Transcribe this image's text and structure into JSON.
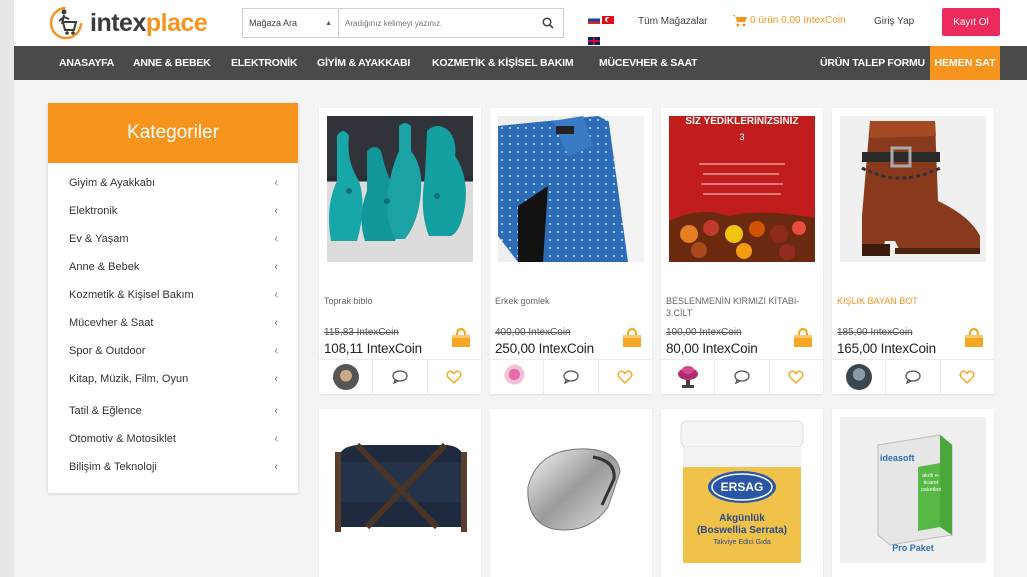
{
  "header": {
    "logo_text_pre": "intex",
    "logo_text_post": "place",
    "store_select": "Mağaza Ara",
    "search_placeholder": "Aradığınız kelimeyi yazınız.",
    "all_stores": "Tüm Mağazalar",
    "cart": "0 ürün 0,00 IntexCoin",
    "login": "Giriş Yap",
    "register": "Kayıt Ol"
  },
  "nav": {
    "items": [
      "ANASAYFA",
      "ANNE & BEBEK",
      "ELEKTRONİK",
      "GİYİM & AYAKKABI",
      "KOZMETİK & KİŞİSEL BAKIM",
      "MÜCEVHER & SAAT"
    ],
    "request_form": "ÜRÜN TALEP FORMU",
    "sell_now": "HEMEN SAT"
  },
  "sidebar": {
    "title": "Kategoriler",
    "items": [
      "Giyim & Ayakkabı",
      "Elektronik",
      "Ev & Yaşam",
      "Anne & Bebek",
      "Kozmetik & Kişisel Bakım",
      "Mücevher & Saat",
      "Spor & Outdoor",
      "Kitap, Müzik, Film, Oyun",
      "Tatil & Eğlence",
      "Otomotiv & Motosiklet",
      "Bilişim & Teknoloji"
    ]
  },
  "products": [
    {
      "name": "Toprak biblo",
      "old_price": "115,83 IntexCoin",
      "price": "108,11 IntexCoin"
    },
    {
      "name": "Erkek gomlek",
      "old_price": "400,00 IntexCoin",
      "price": "250,00 IntexCoin"
    },
    {
      "name": "BESLENMENİN KIRMIZI KİTABI-3.CİLT",
      "old_price": "100,00 IntexCoin",
      "price": "80,00 IntexCoin"
    },
    {
      "name": "KIŞLIK BAYAN BOT",
      "old_price": "185,00 IntexCoin",
      "price": "165,00 IntexCoin"
    }
  ],
  "book_cover": {
    "title": "SİZ YEDİKLERİNİZSİNİZ",
    "volume": "3"
  },
  "ersag": {
    "brand": "ERSAG",
    "product": "Akgünlük",
    "latin": "(Boswellia Serrata)",
    "sub": "Takviye Edici Gıda"
  },
  "ideasoft": {
    "brand": "ideasoft",
    "box_text": "akıllı e-ticaret paketleri",
    "label": "Pro Paket"
  },
  "colors": {
    "accent": "#f7941d",
    "register": "#ec2a5c",
    "nav_bg": "#4a4a4a"
  }
}
